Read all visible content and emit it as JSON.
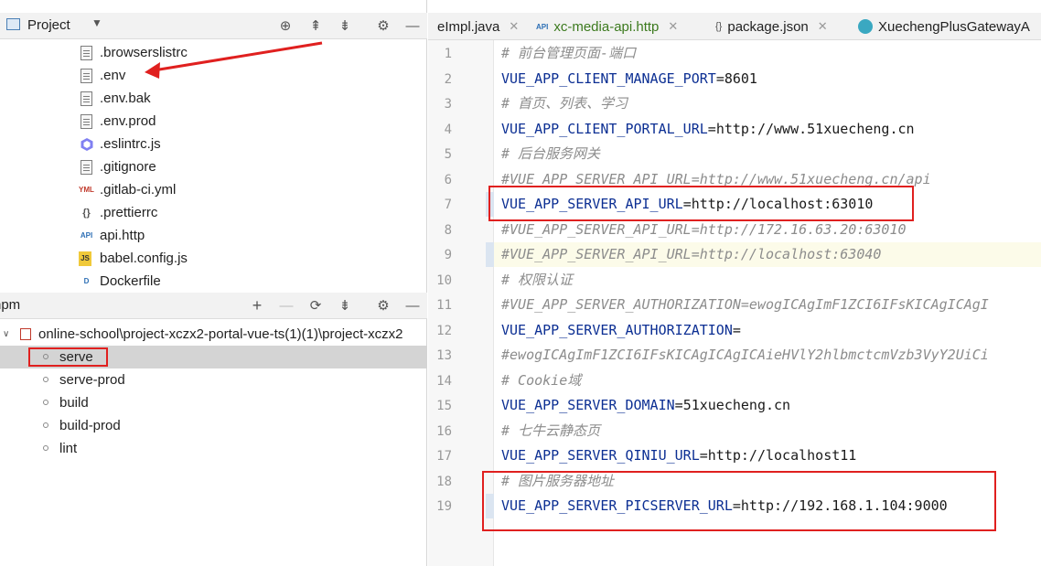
{
  "project_panel": {
    "title": "Project",
    "files": [
      {
        "name": ".browserslistrc",
        "icon": "text-file-icon"
      },
      {
        "name": ".env",
        "icon": "text-file-icon"
      },
      {
        "name": ".env.bak",
        "icon": "text-file-icon"
      },
      {
        "name": ".env.prod",
        "icon": "text-file-icon"
      },
      {
        "name": ".eslintrc.js",
        "icon": "eslint-icon"
      },
      {
        "name": ".gitignore",
        "icon": "gitignore-icon"
      },
      {
        "name": ".gitlab-ci.yml",
        "icon": "yml-file-icon"
      },
      {
        "name": ".prettierrc",
        "icon": "json-file-icon"
      },
      {
        "name": "api.http",
        "icon": "http-api-icon"
      },
      {
        "name": "babel.config.js",
        "icon": "js-file-icon"
      },
      {
        "name": "Dockerfile",
        "icon": "docker-file-icon"
      }
    ]
  },
  "npm_panel": {
    "title": "npm",
    "project": "online-school\\project-xczx2-portal-vue-ts(1)(1)\\project-xczx2",
    "scripts": [
      "serve",
      "serve-prod",
      "build",
      "build-prod",
      "lint"
    ]
  },
  "tabs": [
    {
      "label": "eImpl.java"
    },
    {
      "label": "xc-media-api.http"
    },
    {
      "label": "package.json"
    },
    {
      "label": "XuechengPlusGatewayA"
    }
  ],
  "editor": {
    "lines": [
      {
        "n": "1",
        "type": "comment",
        "text": "# 前台管理页面-端口"
      },
      {
        "n": "2",
        "type": "kv",
        "key": "VUE_APP_CLIENT_MANAGE_PORT",
        "value": "8601"
      },
      {
        "n": "3",
        "type": "comment",
        "text": "# 首页、列表、学习"
      },
      {
        "n": "4",
        "type": "kv",
        "key": "VUE_APP_CLIENT_PORTAL_URL",
        "value": "http://www.51xuecheng.cn"
      },
      {
        "n": "5",
        "type": "comment",
        "text": "# 后台服务网关"
      },
      {
        "n": "6",
        "type": "comment",
        "text": "#VUE_APP_SERVER_API_URL=http://www.51xuecheng.cn/api"
      },
      {
        "n": "7",
        "type": "kv",
        "key": "VUE_APP_SERVER_API_URL",
        "value": "http://localhost:63010"
      },
      {
        "n": "8",
        "type": "comment",
        "text": "#VUE_APP_SERVER_API_URL=http://172.16.63.20:63010"
      },
      {
        "n": "9",
        "type": "comment",
        "text": "#VUE_APP_SERVER_API_URL=http://localhost:63040"
      },
      {
        "n": "10",
        "type": "comment",
        "text": "# 权限认证"
      },
      {
        "n": "11",
        "type": "comment",
        "text": "#VUE_APP_SERVER_AUTHORIZATION=ewogICAgImF1ZCI6IFsKICAgICAgI"
      },
      {
        "n": "12",
        "type": "kv",
        "key": "VUE_APP_SERVER_AUTHORIZATION",
        "value": ""
      },
      {
        "n": "13",
        "type": "comment",
        "text": "#ewogICAgImF1ZCI6IFsKICAgICAgICAieHVlY2hlbmctcmVzb3VyY2UiCi"
      },
      {
        "n": "14",
        "type": "comment",
        "text": "# Cookie域"
      },
      {
        "n": "15",
        "type": "kv",
        "key": "VUE_APP_SERVER_DOMAIN",
        "value": "51xuecheng.cn"
      },
      {
        "n": "16",
        "type": "comment",
        "text": "# 七牛云静态页"
      },
      {
        "n": "17",
        "type": "kv",
        "key": "VUE_APP_SERVER_QINIU_URL",
        "value": "http://localhost11"
      },
      {
        "n": "18",
        "type": "comment",
        "text": "# 图片服务器地址"
      },
      {
        "n": "19",
        "type": "kv",
        "key": "VUE_APP_SERVER_PICSERVER_URL",
        "value": "http://192.168.1.104:9000"
      }
    ]
  },
  "colors": {
    "annotation": "#e0201f",
    "key": "#0c2f93",
    "comment": "#8c8c8c"
  }
}
